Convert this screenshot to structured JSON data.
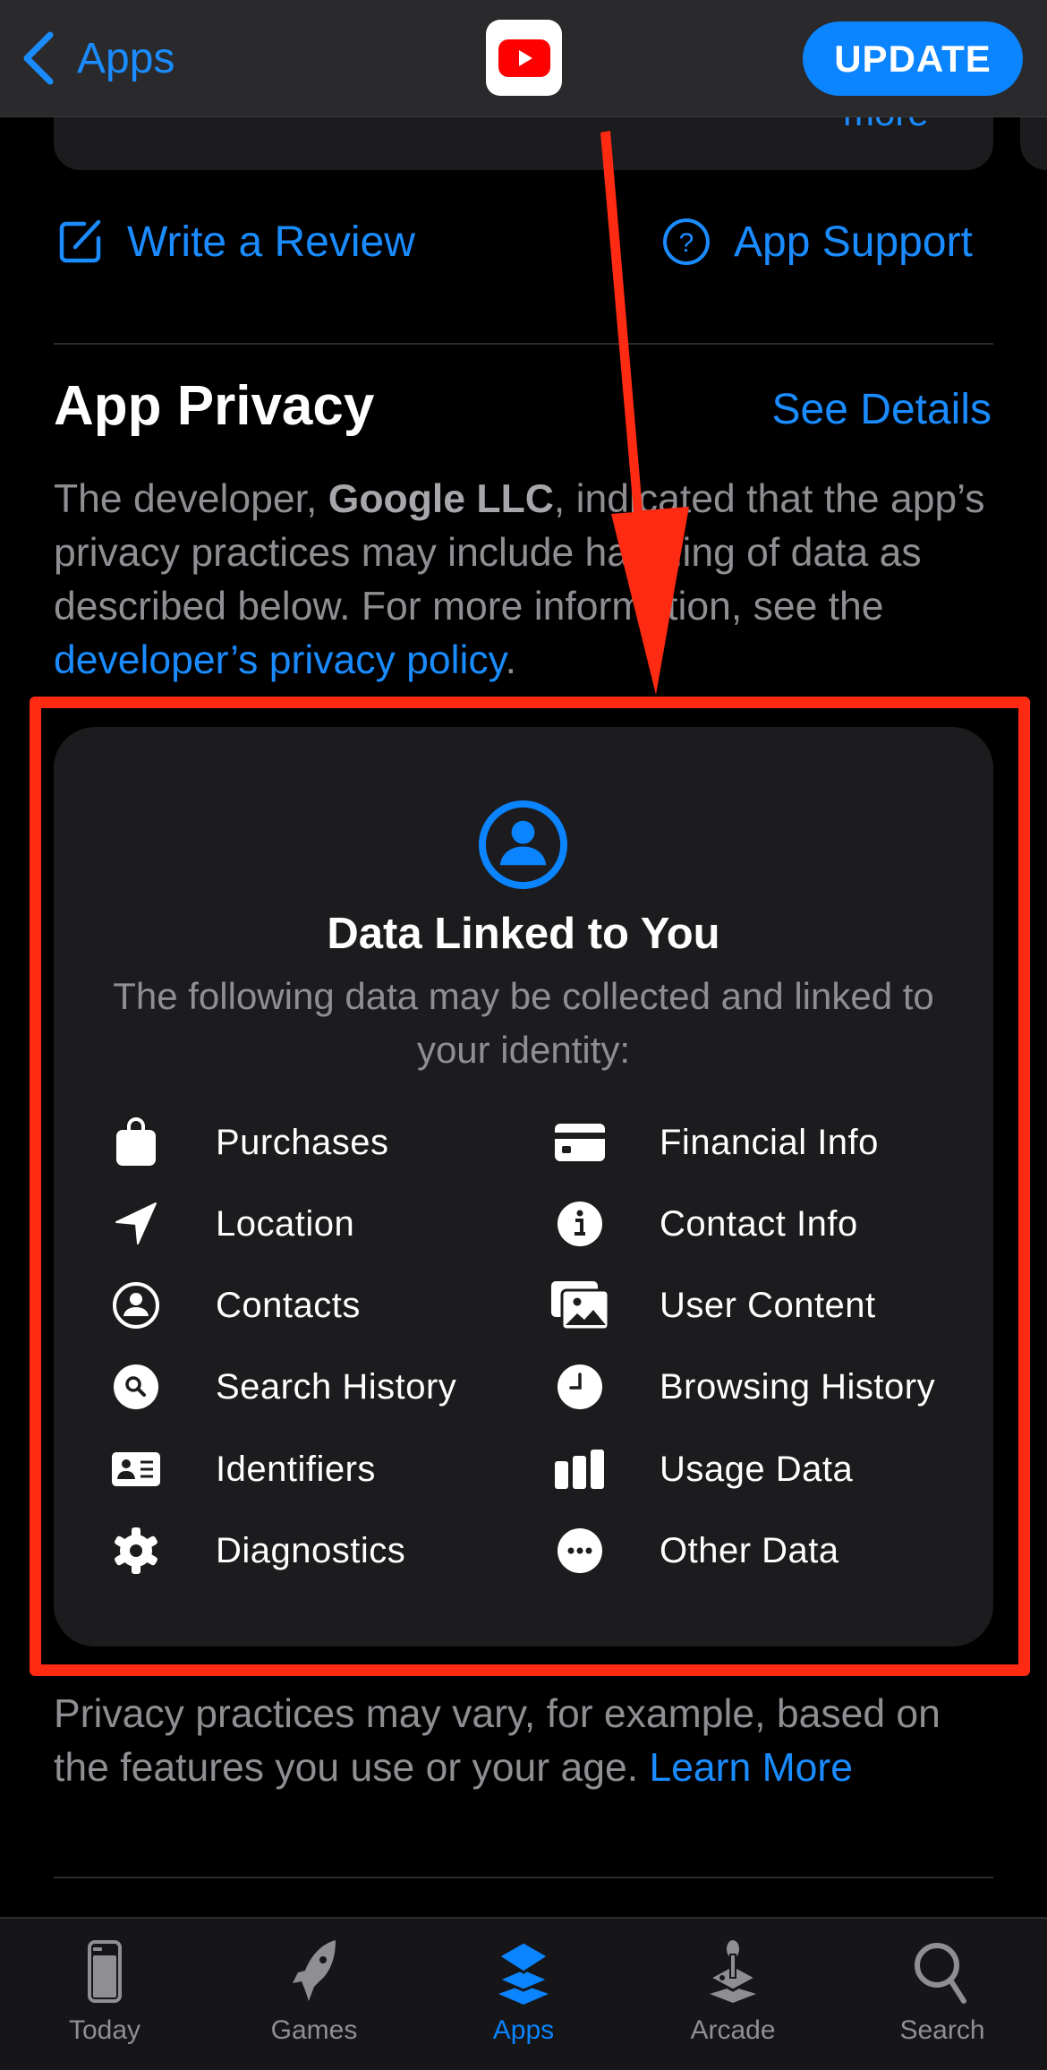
{
  "navbar": {
    "back_label": "Apps",
    "app_icon": "youtube-app-icon",
    "update_label": "UPDATE",
    "previous_card_link": "more"
  },
  "links": {
    "write_review": "Write a Review",
    "app_support": "App Support"
  },
  "privacy": {
    "title": "App Privacy",
    "see_details": "See Details",
    "intro_prefix": "The developer, ",
    "developer_name": "Google LLC",
    "intro_middle": ", indicated that the app’s privacy practices may include handling of data as described below. For more information, see the ",
    "policy_link": "developer’s privacy policy",
    "intro_suffix": ".",
    "card": {
      "icon": "person-circle-icon",
      "title": "Data Linked to You",
      "subtitle": "The following data may be collected and linked to your identity:",
      "items": [
        {
          "label": "Purchases",
          "icon": "shopping-bag-icon"
        },
        {
          "label": "Financial Info",
          "icon": "credit-card-icon"
        },
        {
          "label": "Location",
          "icon": "location-arrow-icon"
        },
        {
          "label": "Contact Info",
          "icon": "info-circle-icon"
        },
        {
          "label": "Contacts",
          "icon": "person-circle-icon"
        },
        {
          "label": "User Content",
          "icon": "photos-icon"
        },
        {
          "label": "Search History",
          "icon": "search-circle-icon"
        },
        {
          "label": "Browsing History",
          "icon": "clock-icon"
        },
        {
          "label": "Identifiers",
          "icon": "id-card-icon"
        },
        {
          "label": "Usage Data",
          "icon": "bar-chart-icon"
        },
        {
          "label": "Diagnostics",
          "icon": "gear-icon"
        },
        {
          "label": "Other Data",
          "icon": "ellipsis-circle-icon"
        }
      ]
    },
    "footer_text": "Privacy practices may vary, for example, based on the features you use or your age. ",
    "learn_more": "Learn More"
  },
  "colors": {
    "accent": "#0a84ff",
    "link": "#1a8cff",
    "annotation": "#ff2a12",
    "card_bg": "#1c1c1e",
    "secondary_text": "#8e8e93"
  },
  "tabbar": {
    "active": "Apps",
    "tabs": [
      {
        "label": "Today",
        "icon": "today-icon"
      },
      {
        "label": "Games",
        "icon": "rocket-icon"
      },
      {
        "label": "Apps",
        "icon": "apps-stack-icon"
      },
      {
        "label": "Arcade",
        "icon": "joystick-icon"
      },
      {
        "label": "Search",
        "icon": "search-icon"
      }
    ]
  }
}
